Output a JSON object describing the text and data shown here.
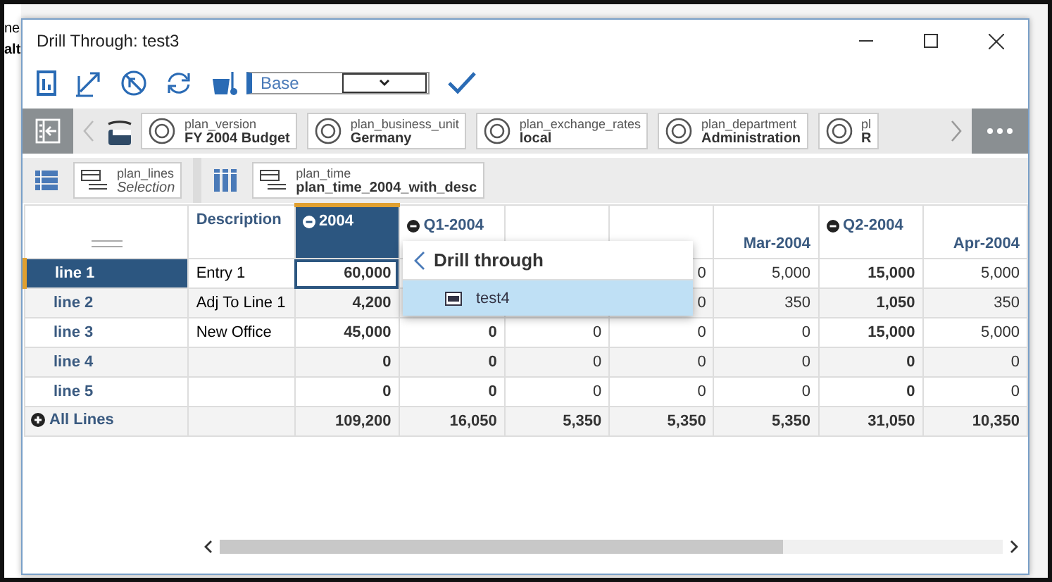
{
  "background_window": {
    "texts": [
      "ne",
      "alt"
    ]
  },
  "window": {
    "title": "Drill Through: test3"
  },
  "toolbar": {
    "version_select": {
      "value": "Base"
    }
  },
  "filters": [
    {
      "name": "plan_version",
      "value": "FY 2004 Budget"
    },
    {
      "name": "plan_business_unit",
      "value": "Germany"
    },
    {
      "name": "plan_exchange_rates",
      "value": "local"
    },
    {
      "name": "plan_department",
      "value": "Administration"
    },
    {
      "name": "pl",
      "value": "R"
    }
  ],
  "axes": [
    {
      "kind": "rows",
      "name": "plan_lines",
      "value": "Selection"
    },
    {
      "kind": "columns",
      "name": "plan_time",
      "value": "plan_time_2004_with_desc"
    }
  ],
  "grid": {
    "columns": [
      {
        "label": "Description",
        "kind": "text",
        "selected": false
      },
      {
        "label": "2004",
        "kind": "subtotal",
        "selected": true
      },
      {
        "label": "Q1-2004",
        "kind": "subtotal",
        "selected": false
      },
      {
        "kind": "period",
        "selected": false
      },
      {
        "kind": "period",
        "selected": false
      },
      {
        "label": "Mar-2004",
        "kind": "period",
        "selected": false
      },
      {
        "label": "Q2-2004",
        "kind": "subtotal",
        "selected": false
      },
      {
        "label": "Apr-2004",
        "kind": "period",
        "selected": false
      }
    ],
    "rows": [
      {
        "label": "line 1",
        "selected": true,
        "kind": "line",
        "cells": [
          "Entry 1",
          "60,000",
          "",
          "",
          "0",
          "5,000",
          "15,000",
          "5,000"
        ]
      },
      {
        "label": "line 2",
        "selected": false,
        "kind": "line",
        "cells": [
          "Adj To Line 1",
          "4,200",
          "",
          "",
          "0",
          "350",
          "1,050",
          "350"
        ]
      },
      {
        "label": "line 3",
        "selected": false,
        "kind": "line",
        "cells": [
          "New Office",
          "45,000",
          "0",
          "0",
          "0",
          "0",
          "15,000",
          "5,000"
        ]
      },
      {
        "label": "line 4",
        "selected": false,
        "kind": "line",
        "cells": [
          "",
          "0",
          "0",
          "0",
          "0",
          "0",
          "0",
          "0"
        ]
      },
      {
        "label": "line 5",
        "selected": false,
        "kind": "line",
        "cells": [
          "",
          "0",
          "0",
          "0",
          "0",
          "0",
          "0",
          "0"
        ]
      },
      {
        "label": "All Lines",
        "selected": false,
        "kind": "total",
        "cells": [
          "",
          "109,200",
          "16,050",
          "5,350",
          "5,350",
          "5,350",
          "31,050",
          "10,350"
        ]
      }
    ]
  },
  "popup": {
    "title": "Drill through",
    "items": [
      {
        "label": "test4",
        "selected": true
      }
    ]
  }
}
